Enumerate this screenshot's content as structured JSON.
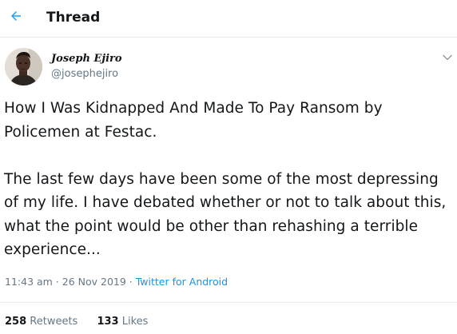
{
  "header": {
    "back_icon": "back-arrow-icon",
    "title": "Thread"
  },
  "tweet": {
    "author": {
      "name": "Joseph Ejiro",
      "handle": "@josephejiro",
      "avatar": "avatar-photo"
    },
    "menu_icon": "chevron-down-icon",
    "paragraphs": [
      "How I Was Kidnapped And Made To Pay Ransom by Policemen at Festac.",
      "The last few days have been some of the most depressing of my life. I have debated whether or not to talk about this, what the point would be other than rehashing a terrible experience..."
    ],
    "timestamp": "11:43 am · 26 Nov 2019 · ",
    "source": "Twitter for Android",
    "stats": {
      "retweets_count": "258",
      "retweets_label": "Retweets",
      "likes_count": "133",
      "likes_label": "Likes"
    }
  },
  "colors": {
    "accent": "#1b95e0",
    "text": "#14171a",
    "secondary": "#657786",
    "border": "#e6ecf0"
  }
}
